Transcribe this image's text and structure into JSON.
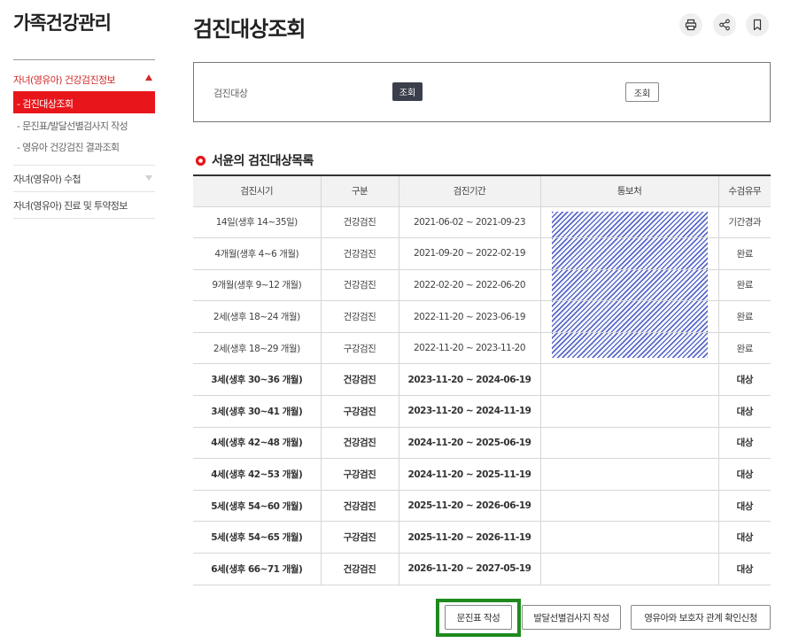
{
  "sidebar": {
    "title": "가족건강관리",
    "menu_open_label": "자녀(영유아) 건강검진정보",
    "submenu": [
      {
        "label": "- 검진대상조회",
        "active": true
      },
      {
        "label": "- 문진표/발달선별검사지 작성",
        "active": false
      },
      {
        "label": "- 영유아 건강검진 결과조회",
        "active": false
      }
    ],
    "menu_items": [
      {
        "label": "자녀(영유아) 수첩"
      },
      {
        "label": "자녀(영유아) 진료 및 투약정보"
      }
    ]
  },
  "header": {
    "title": "검진대상조회",
    "icons": [
      "print-icon",
      "share-icon",
      "bookmark-icon"
    ]
  },
  "search": {
    "label": "검진대상",
    "selected_value": "조회",
    "button_label": "조회"
  },
  "section": {
    "title": "서윤의 검진대상목록"
  },
  "table": {
    "headers": [
      "검진시기",
      "구분",
      "검진기간",
      "통보처",
      "수검유무"
    ],
    "rows": [
      {
        "period": "14일(생후 14~35일)",
        "type": "건강검진",
        "range": "2021-06-02 ~ 2021-09-23",
        "notice": "",
        "status": "기간경과"
      },
      {
        "period": "4개월(생후 4~6 개월)",
        "type": "건강검진",
        "range": "2021-09-20 ~ 2022-02-19",
        "notice": "",
        "status": "완료"
      },
      {
        "period": "9개월(생후 9~12 개월)",
        "type": "건강검진",
        "range": "2022-02-20 ~ 2022-06-20",
        "notice": "",
        "status": "완료"
      },
      {
        "period": "2세(생후 18~24 개월)",
        "type": "건강검진",
        "range": "2022-11-20 ~ 2023-06-19",
        "notice": "",
        "status": "완료"
      },
      {
        "period": "2세(생후 18~29 개월)",
        "type": "구강검진",
        "range": "2022-11-20 ~ 2023-11-20",
        "notice": "",
        "status": "완료"
      },
      {
        "period": "3세(생후 30~36 개월)",
        "type": "건강검진",
        "range": "2023-11-20 ~ 2024-06-19",
        "notice": "",
        "status": "대상"
      },
      {
        "period": "3세(생후 30~41 개월)",
        "type": "구강검진",
        "range": "2023-11-20 ~ 2024-11-19",
        "notice": "",
        "status": "대상"
      },
      {
        "period": "4세(생후 42~48 개월)",
        "type": "건강검진",
        "range": "2024-11-20 ~ 2025-06-19",
        "notice": "",
        "status": "대상"
      },
      {
        "period": "4세(생후 42~53 개월)",
        "type": "구강검진",
        "range": "2024-11-20 ~ 2025-11-19",
        "notice": "",
        "status": "대상"
      },
      {
        "period": "5세(생후 54~60 개월)",
        "type": "건강검진",
        "range": "2025-11-20 ~ 2026-06-19",
        "notice": "",
        "status": "대상"
      },
      {
        "period": "5세(생후 54~65 개월)",
        "type": "구강검진",
        "range": "2025-11-20 ~ 2026-11-19",
        "notice": "",
        "status": "대상"
      },
      {
        "period": "6세(생후 66~71 개월)",
        "type": "건강검진",
        "range": "2026-11-20 ~ 2027-05-19",
        "notice": "",
        "status": "대상"
      }
    ]
  },
  "buttons": {
    "questionnaire": "문진표 작성",
    "development": "발달선별검사지 작성",
    "guardian": "영유아와 보호자 관계 확인신청"
  },
  "colors": {
    "accent_red": "#e8161b",
    "status_red": "#d12a2a",
    "dark_button": "#3a3f4b",
    "highlight_green": "#1e8a1e",
    "hatch_blue": "#5868c9"
  }
}
